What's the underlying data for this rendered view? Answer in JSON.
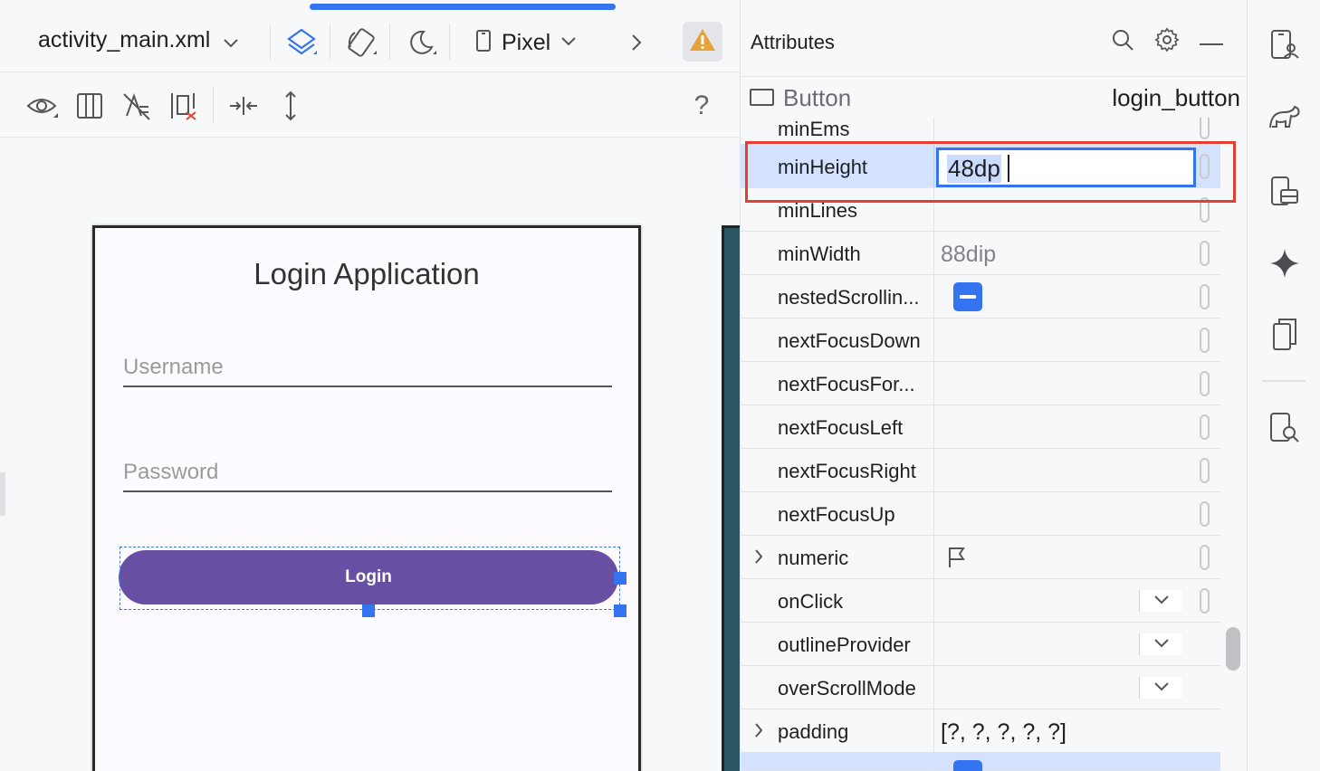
{
  "editor": {
    "file_name": "activity_main.xml",
    "device_label": "Pixel",
    "help_label": "?"
  },
  "preview": {
    "app_title": "Login Application",
    "username_hint": "Username",
    "password_hint": "Password",
    "login_label": "Login"
  },
  "attributes": {
    "title": "Attributes",
    "component_type": "Button",
    "component_id": "login_button",
    "rows": [
      {
        "name": "minEms",
        "value": ""
      },
      {
        "name": "minHeight",
        "value": "48dp"
      },
      {
        "name": "minLines",
        "value": ""
      },
      {
        "name": "minWidth",
        "value": "88dip"
      },
      {
        "name": "nestedScrollin...",
        "value": ""
      },
      {
        "name": "nextFocusDown",
        "value": ""
      },
      {
        "name": "nextFocusFor...",
        "value": ""
      },
      {
        "name": "nextFocusLeft",
        "value": ""
      },
      {
        "name": "nextFocusRight",
        "value": ""
      },
      {
        "name": "nextFocusUp",
        "value": ""
      },
      {
        "name": "numeric",
        "value": ""
      },
      {
        "name": "onClick",
        "value": ""
      },
      {
        "name": "outlineProvider",
        "value": ""
      },
      {
        "name": "overScrollMode",
        "value": ""
      },
      {
        "name": "padding",
        "value": "[?, ?, ?, ?, ?]"
      }
    ]
  },
  "colors": {
    "accent": "#3574f0",
    "button_purple": "#6750a4",
    "highlight_frame": "#e2412f",
    "selected_row": "#d4e2ff",
    "warning": "#e8a23a"
  }
}
